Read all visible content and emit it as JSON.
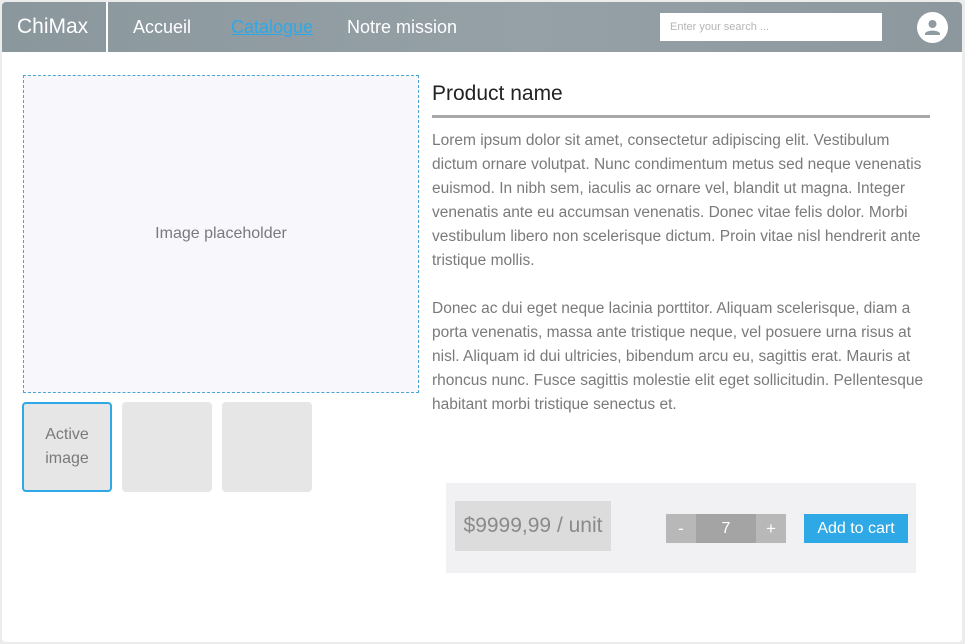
{
  "header": {
    "brand": "ChiMax",
    "nav": [
      {
        "label": "Accueil",
        "active": false
      },
      {
        "label": "Catalogue",
        "active": true
      },
      {
        "label": "Notre mission",
        "active": false
      }
    ],
    "search_placeholder": "Enter your search ...",
    "avatar_icon": "user-avatar-icon"
  },
  "gallery": {
    "main_image_label": "Image placeholder",
    "thumbnails": [
      {
        "label": "Active\nimage",
        "active": true
      },
      {
        "label": "",
        "active": false
      },
      {
        "label": "",
        "active": false
      }
    ]
  },
  "product": {
    "name": "Product name",
    "paragraphs": [
      "Lorem ipsum dolor sit amet, consectetur adipiscing elit. Vestibulum dictum ornare volutpat. Nunc condimentum metus sed neque venenatis euismod. In nibh sem, iaculis ac ornare vel, blandit ut magna. Integer venenatis ante eu accumsan venenatis. Donec vitae felis dolor. Morbi vestibulum libero non scelerisque dictum. Proin vitae nisl hendrerit ante tristique mollis.",
      "Donec ac dui eget neque lacinia porttitor. Aliquam scelerisque, diam a porta venenatis, massa ante tristique neque, vel posuere urna risus at nisl. Aliquam id dui ultricies, bibendum arcu eu, sagittis erat. Mauris at rhoncus nunc. Fusce sagittis molestie elit eget sollicitudin. Pellentesque habitant morbi tristique senectus et."
    ]
  },
  "purchase": {
    "price": "$9999,99 / unit",
    "decrement_label": "-",
    "quantity": "7",
    "increment_label": "+",
    "add_to_cart_label": "Add to cart"
  },
  "colors": {
    "accent": "#2fa8e6",
    "header_bg": "#8f9ba1",
    "thumb_bg": "#e6e6e6"
  }
}
